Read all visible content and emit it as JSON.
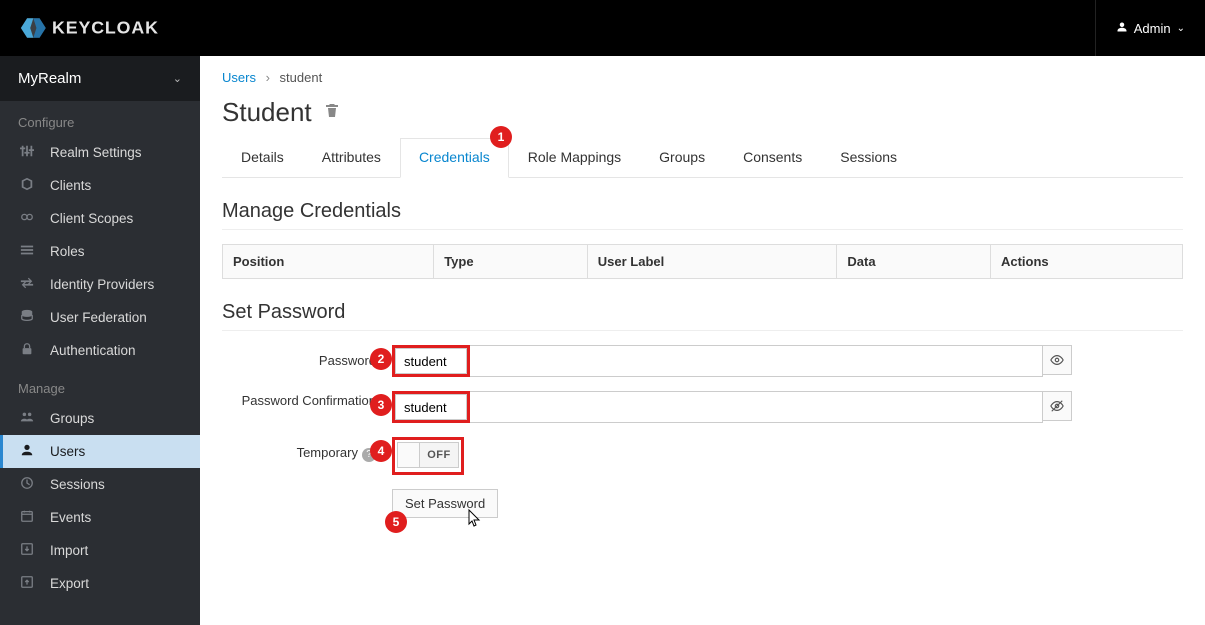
{
  "header": {
    "brand": "KEYCLOAK",
    "user_label": "Admin"
  },
  "sidebar": {
    "realm": "MyRealm",
    "sections": {
      "configure_label": "Configure",
      "manage_label": "Manage"
    },
    "configure": [
      {
        "label": "Realm Settings"
      },
      {
        "label": "Clients"
      },
      {
        "label": "Client Scopes"
      },
      {
        "label": "Roles"
      },
      {
        "label": "Identity Providers"
      },
      {
        "label": "User Federation"
      },
      {
        "label": "Authentication"
      }
    ],
    "manage": [
      {
        "label": "Groups"
      },
      {
        "label": "Users"
      },
      {
        "label": "Sessions"
      },
      {
        "label": "Events"
      },
      {
        "label": "Import"
      },
      {
        "label": "Export"
      }
    ]
  },
  "breadcrumb": {
    "parent": "Users",
    "current": "student"
  },
  "page": {
    "title": "Student"
  },
  "tabs": [
    {
      "label": "Details"
    },
    {
      "label": "Attributes"
    },
    {
      "label": "Credentials"
    },
    {
      "label": "Role Mappings"
    },
    {
      "label": "Groups"
    },
    {
      "label": "Consents"
    },
    {
      "label": "Sessions"
    }
  ],
  "credentials": {
    "manage_title": "Manage Credentials",
    "columns": [
      "Position",
      "Type",
      "User Label",
      "Data",
      "Actions"
    ],
    "set_title": "Set Password",
    "password_label": "Password",
    "password_value": "student",
    "confirm_label": "Password Confirmation",
    "confirm_value": "student",
    "temporary_label": "Temporary",
    "temporary_value": "OFF",
    "submit_label": "Set Password"
  },
  "callouts": [
    "1",
    "2",
    "3",
    "4",
    "5"
  ]
}
